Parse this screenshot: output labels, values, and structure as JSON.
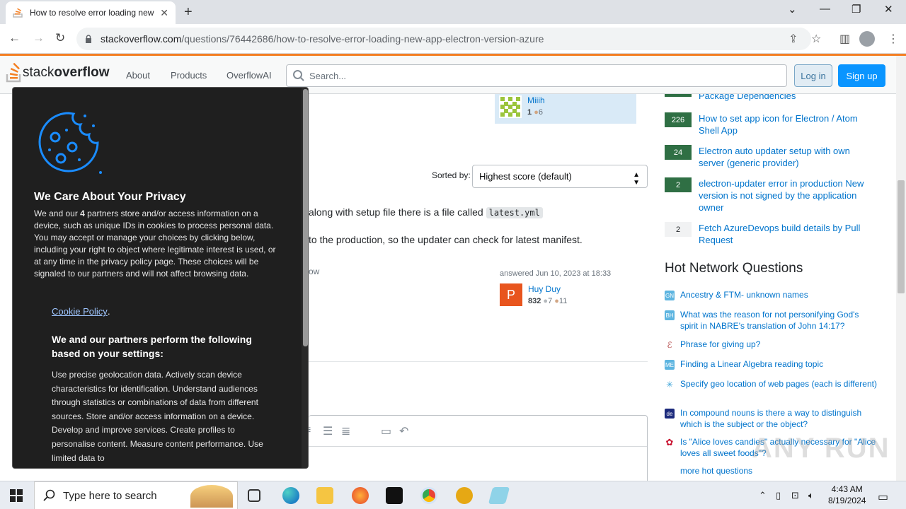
{
  "browser": {
    "tab_title": "How to resolve error loading new",
    "url_domain": "stackoverflow.com",
    "url_path": "/questions/76442686/how-to-resolve-error-loading-new-app-electron-version-azure"
  },
  "so_header": {
    "logo_stack": "stack",
    "logo_overflow": "overflow",
    "nav": [
      "About",
      "Products",
      "OverflowAI"
    ],
    "search_placeholder": "Search...",
    "login": "Log in",
    "signup": "Sign up"
  },
  "question_user": {
    "name": "Miiih",
    "rep": "1",
    "bronze": "6"
  },
  "sort": {
    "label": "Sorted by:",
    "value": "Highest score (default)"
  },
  "answer": {
    "line1": "along with setup file there is a file called",
    "line1_code": "latest.yml",
    "line2": "to the production, so the updater can check for latest manifest.",
    "partial_word": "ow",
    "answered": "answered Jun 10, 2023 at 18:33",
    "user": {
      "initial": "P",
      "name": "Huy Duy",
      "rep": "832",
      "silver": "7",
      "bronze": "11"
    }
  },
  "related": [
    {
      "votes": "",
      "title": "Package Dependencies",
      "accepted": true
    },
    {
      "votes": "226",
      "title": "How to set app icon for Electron / Atom Shell App",
      "accepted": true
    },
    {
      "votes": "24",
      "title": "Electron auto updater setup with own server (generic provider)",
      "accepted": true
    },
    {
      "votes": "2",
      "title": "electron-updater error in production New version is not signed by the application owner",
      "accepted": true
    },
    {
      "votes": "2",
      "title": "Fetch AzureDevops build details by Pull Request",
      "accepted": false
    }
  ],
  "hot": {
    "title": "Hot Network Questions",
    "items": [
      {
        "icon": "GN",
        "color": "#5eb5e0",
        "title": "Ancestry & FTM- unknown names"
      },
      {
        "icon": "BH",
        "color": "#5eb5e0",
        "title": "What was the reason for not personifying God's spirit in NABRE's translation of John 14:17?"
      },
      {
        "icon": "",
        "color": "#b04040",
        "title": "Phrase for giving up?"
      },
      {
        "icon": "ME",
        "color": "#5eb5e0",
        "title": "Finding a Linear Algebra reading topic"
      },
      {
        "icon": "",
        "color": "#3ca4d8",
        "title": "Specify geo location of web pages (each is different)"
      },
      {
        "icon": "de",
        "color": "#1c2a7c",
        "title": "In compound nouns is there a way to distinguish which is the subject or the object?"
      },
      {
        "icon": "",
        "color": "#c8102e",
        "title": "Is \"Alice loves candies\" actually necessary for \"Alice loves all sweet foods\"?"
      }
    ],
    "more": "more hot questions"
  },
  "cookie": {
    "title": "We Care About Your Privacy",
    "desc_pre": "We and our ",
    "desc_count": "4",
    "desc_post": " partners store and/or access information on a device, such as unique IDs in cookies to process personal data. You may accept or manage your choices by clicking below, including your right to object where legitimate interest is used, or at any time in the privacy policy page. These choices will be signaled to our partners and will not affect browsing data.",
    "policy_link": "Cookie Policy",
    "subtitle": "We and our partners perform the following based on your settings:",
    "purposes": "Use precise geolocation data. Actively scan device characteristics for identification. Understand audiences through statistics or combinations of data from different sources. Store and/or access information on a device. Develop and improve services. Create profiles to personalise content. Measure content performance. Use limited data to"
  },
  "watermark": "ANY RUN",
  "taskbar": {
    "search_placeholder": "Type here to search",
    "time": "4:43 AM",
    "date": "8/19/2024"
  }
}
